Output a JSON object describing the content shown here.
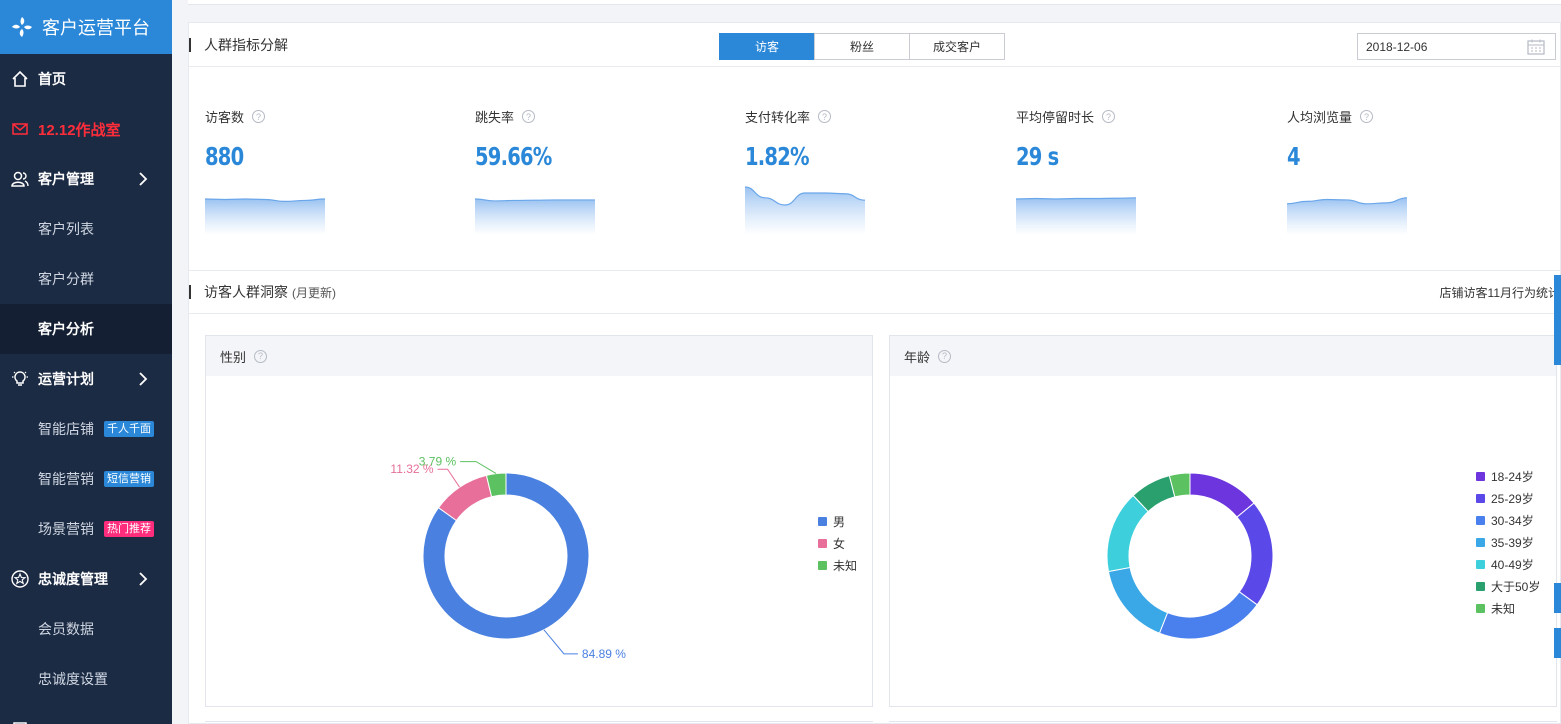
{
  "app": {
    "title": "客户运营平台"
  },
  "sidebar": {
    "home": "首页",
    "war_room": "12.12作战室",
    "customer_mgmt": "客户管理",
    "customer_list": "客户列表",
    "customer_group": "客户分群",
    "customer_analysis": "客户分析",
    "ops_plan": "运营计划",
    "smart_store": "智能店铺",
    "smart_store_badge": "千人千面",
    "smart_marketing": "智能营销",
    "smart_marketing_badge": "短信营销",
    "scene_marketing": "场景营销",
    "scene_marketing_badge": "热门推荐",
    "loyalty_mgmt": "忠诚度管理",
    "member_data": "会员数据",
    "loyalty_settings": "忠诚度设置"
  },
  "indicators": {
    "title": "人群指标分解",
    "tabs": [
      "访客",
      "粉丝",
      "成交客户"
    ],
    "active_tab": "访客",
    "date": "2018-12-06",
    "metrics": [
      {
        "label": "访客数",
        "value": "880",
        "trend": [
          0.5,
          0.52,
          0.5,
          0.52,
          0.6,
          0.56,
          0.5
        ]
      },
      {
        "label": "跳失率",
        "value": "59.66%",
        "trend": [
          0.5,
          0.58,
          0.56,
          0.55,
          0.54,
          0.54,
          0.54
        ]
      },
      {
        "label": "支付转化率",
        "value": "1.82%",
        "trend": [
          0.0,
          0.45,
          0.75,
          0.25,
          0.25,
          0.28,
          0.55
        ]
      },
      {
        "label": "平均停留时长",
        "value": "29 s",
        "trend": [
          0.5,
          0.48,
          0.5,
          0.48,
          0.48,
          0.47,
          0.45
        ]
      },
      {
        "label": "人均浏览量",
        "value": "4",
        "trend": [
          0.7,
          0.6,
          0.52,
          0.54,
          0.7,
          0.66,
          0.45
        ]
      }
    ]
  },
  "insight": {
    "title": "访客人群洞察",
    "subtitle": "(月更新)",
    "note": "店铺访客11月行为统计"
  },
  "gender_card": {
    "title": "性别",
    "chart_data": {
      "type": "pie",
      "categories": [
        "男",
        "女",
        "未知"
      ],
      "values": [
        84.89,
        11.32,
        3.79
      ],
      "labels": [
        "84.89 %",
        "11.32 %",
        "3.79 %"
      ],
      "colors": [
        "#4a80e0",
        "#e86f9a",
        "#5cc160"
      ],
      "legend": "right"
    }
  },
  "age_card": {
    "title": "年龄",
    "chart_data": {
      "type": "pie",
      "categories": [
        "18-24岁",
        "25-29岁",
        "30-34岁",
        "35-39岁",
        "40-49岁",
        "大于50岁",
        "未知"
      ],
      "values": [
        14,
        21,
        21,
        16,
        16,
        8,
        4
      ],
      "colors": [
        "#6c35de",
        "#5a48e8",
        "#4a80ee",
        "#3aa7e6",
        "#3dd0dc",
        "#2aa06f",
        "#5cc160"
      ],
      "legend": "right"
    }
  }
}
